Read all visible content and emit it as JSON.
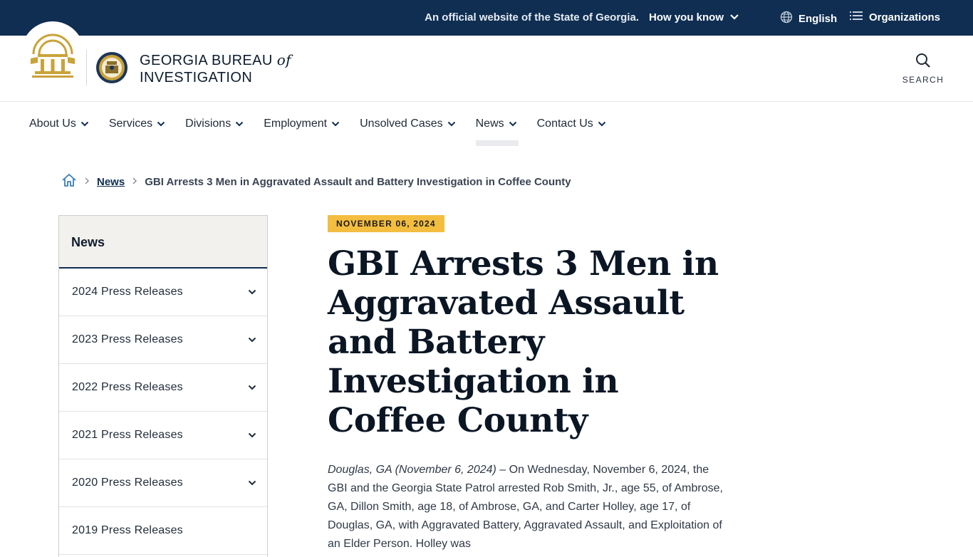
{
  "topbar": {
    "official_text": "An official website of the State of Georgia.",
    "how_you_know": "How you know",
    "language": "English",
    "organizations": "Organizations"
  },
  "header": {
    "org_name_line1": "GEORGIA BUREAU",
    "org_name_of": "of",
    "org_name_line2": "INVESTIGATION",
    "search_label": "SEARCH"
  },
  "nav": {
    "items": [
      {
        "label": "About Us"
      },
      {
        "label": "Services"
      },
      {
        "label": "Divisions"
      },
      {
        "label": "Employment"
      },
      {
        "label": "Unsolved Cases"
      },
      {
        "label": "News",
        "active": true
      },
      {
        "label": "Contact Us"
      }
    ]
  },
  "breadcrumb": {
    "section": "News",
    "current": "GBI Arrests 3 Men in Aggravated Assault and Battery Investigation in Coffee County"
  },
  "sidebar": {
    "title": "News",
    "items": [
      {
        "label": "2024 Press Releases"
      },
      {
        "label": "2023 Press Releases"
      },
      {
        "label": "2022 Press Releases"
      },
      {
        "label": "2021 Press Releases"
      },
      {
        "label": "2020 Press Releases"
      },
      {
        "label": "2019 Press Releases"
      }
    ]
  },
  "article": {
    "date": "NOVEMBER 06, 2024",
    "title": "GBI Arrests 3 Men in Aggravated Assault and Battery Investigation in Coffee County",
    "dateline": "Douglas, GA (November 6, 2024)",
    "body": " – On Wednesday, November 6, 2024, the GBI and the Georgia State Patrol arrested Rob Smith, Jr., age 55, of Ambrose, GA, Dillon Smith, age 18, of Ambrose, GA, and Carter Holley, age 17, of Douglas, GA, with Aggravated Battery, Aggravated Assault, and Exploitation of an Elder Person. Holley was"
  },
  "colors": {
    "navy": "#0f2e52",
    "gold": "#f3bd3f",
    "seal_gold": "#c9a23a"
  }
}
